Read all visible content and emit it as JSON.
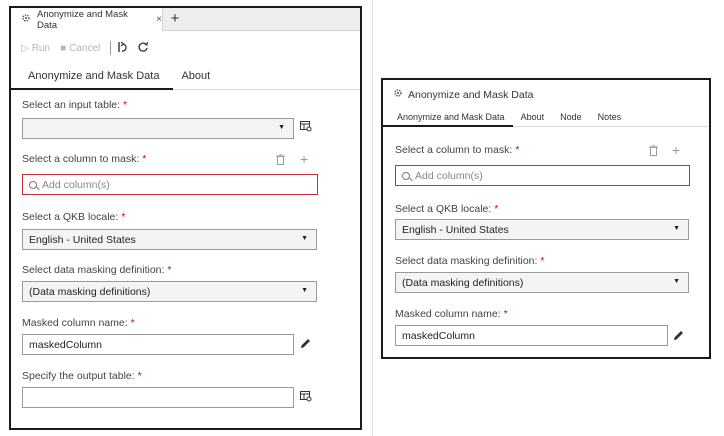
{
  "left": {
    "doc_tab": "Anonymize and Mask Data",
    "close_glyph": "×",
    "add_tab_glyph": "+",
    "toolbar": {
      "run": "Run",
      "cancel": "Cancel"
    },
    "tabs": [
      "Anonymize and Mask Data",
      "About"
    ],
    "fields": {
      "input_table": {
        "label": "Select an input table:",
        "value": ""
      },
      "column_to_mask": {
        "label": "Select a column to mask:",
        "placeholder": "Add column(s)"
      },
      "qkb_locale": {
        "label": "Select a QKB locale:",
        "value": "English - United States"
      },
      "masking_def": {
        "label": "Select data masking definition:",
        "value": "(Data masking definitions)"
      },
      "masked_name": {
        "label": "Masked column name:",
        "value": "maskedColumn"
      },
      "output_table": {
        "label": "Specify the output table:",
        "value": ""
      }
    }
  },
  "right": {
    "title": "Anonymize and Mask Data",
    "tabs": [
      "Anonymize and Mask Data",
      "About",
      "Node",
      "Notes"
    ],
    "fields": {
      "column_to_mask": {
        "label": "Select a column to mask:",
        "placeholder": "Add column(s)"
      },
      "qkb_locale": {
        "label": "Select a QKB locale:",
        "value": "English - United States"
      },
      "masking_def": {
        "label": "Select data masking definition:",
        "value": "(Data masking definitions)"
      },
      "masked_name": {
        "label": "Masked column name:",
        "value": "maskedColumn"
      }
    }
  },
  "required_marker": "*",
  "colors": {
    "required": "#d0021b",
    "error_border": "#c9303b",
    "panel_border": "#1a1a1a"
  },
  "icons": [
    "gear-icon",
    "close-icon",
    "plus-icon",
    "play-icon",
    "stop-icon",
    "undo-icon",
    "refresh-icon",
    "table-browse-icon",
    "trash-icon",
    "search-icon",
    "chevron-down-icon",
    "pencil-icon"
  ]
}
